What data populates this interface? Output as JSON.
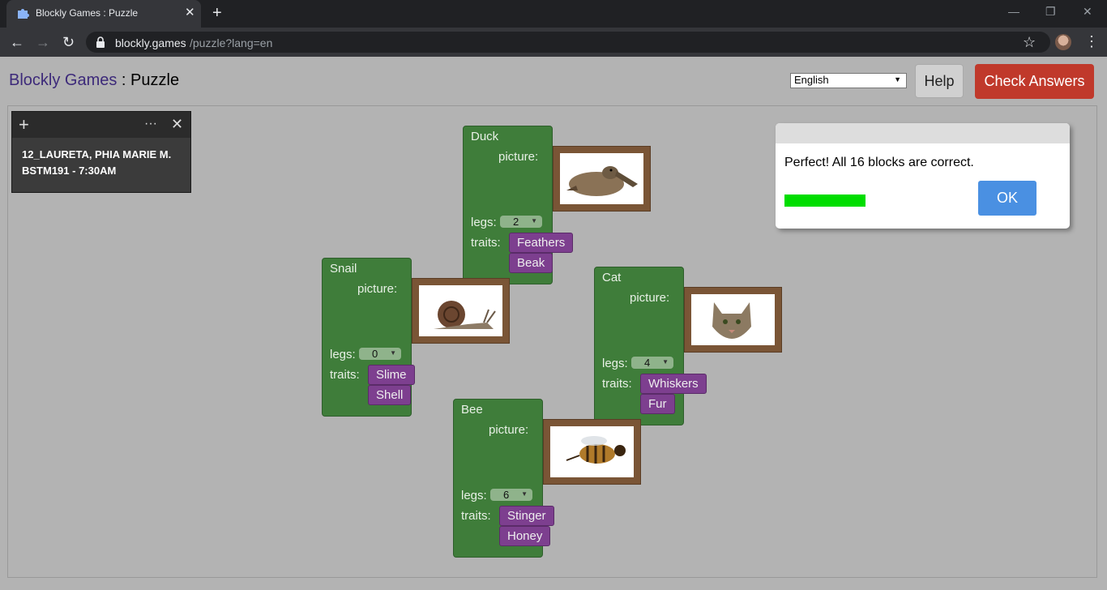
{
  "browser": {
    "tab_title": "Blockly Games : Puzzle",
    "url_host": "blockly.games",
    "url_path": "/puzzle?lang=en"
  },
  "header": {
    "title_link": "Blockly Games",
    "title_sep": " : ",
    "title_page": "Puzzle",
    "language": "English",
    "help_label": "Help",
    "check_label": "Check Answers"
  },
  "sticky_note": {
    "line1": "12_LAURETA, PHIA MARIE M.",
    "line2": "BSTM191 - 7:30AM"
  },
  "labels": {
    "picture": "picture:",
    "legs": "legs:",
    "traits": "traits:"
  },
  "animals": [
    {
      "name": "Duck",
      "legs": "2",
      "traits": [
        "Feathers",
        "Beak"
      ]
    },
    {
      "name": "Snail",
      "legs": "0",
      "traits": [
        "Slime",
        "Shell"
      ]
    },
    {
      "name": "Cat",
      "legs": "4",
      "traits": [
        "Whiskers",
        "Fur"
      ]
    },
    {
      "name": "Bee",
      "legs": "6",
      "traits": [
        "Stinger",
        "Honey"
      ]
    }
  ],
  "dialog": {
    "message": "Perfect! All 16 blocks are correct.",
    "ok_label": "OK",
    "progress": 1.0
  },
  "colors": {
    "block_green": "#3f7d3a",
    "trait_purple": "#7d3f8f",
    "check_red": "#c0392b",
    "ok_blue": "#4a90e2",
    "progress_green": "#00dd00"
  }
}
